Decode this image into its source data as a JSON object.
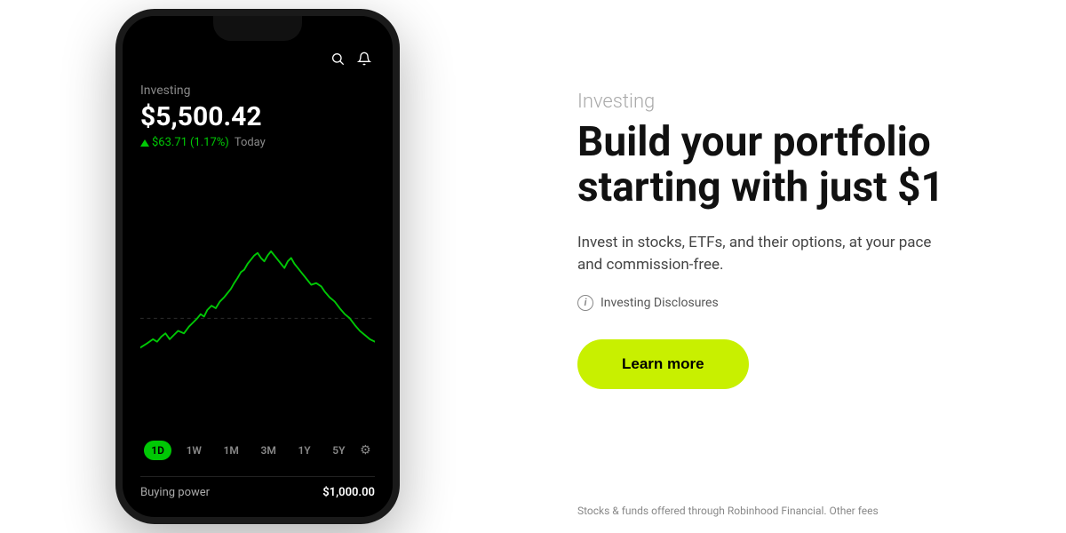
{
  "phone": {
    "investing_label": "Investing",
    "portfolio_value": "$5,500.42",
    "change_amount": "$63.71",
    "change_percent": "(1.17%)",
    "change_period": "Today",
    "tabs": [
      "1D",
      "1W",
      "1M",
      "3M",
      "1Y",
      "5Y"
    ],
    "active_tab": "1D",
    "buying_power_label": "Buying power",
    "buying_power_value": "$1,000.00"
  },
  "content": {
    "section_label": "Investing",
    "headline_line1": "Build your portfolio",
    "headline_line2": "starting with just $1",
    "description": "Invest in stocks, ETFs, and their options, at your pace and commission-free.",
    "disclosures_text": "Investing Disclosures",
    "learn_more_label": "Learn more",
    "footer_text": "Stocks & funds offered through Robinhood Financial. Other fees"
  },
  "icons": {
    "search": "🔍",
    "bell": "🔔",
    "info": "i",
    "gear": "⚙"
  }
}
